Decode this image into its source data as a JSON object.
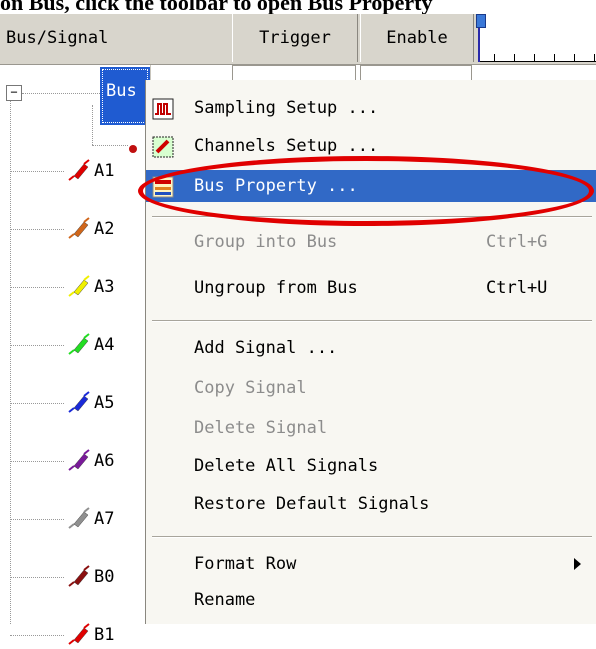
{
  "caption": "on Bus, click the toolbar to open Bus Property",
  "header": {
    "bus_signal": "Bus/Signal",
    "trigger": "Trigger",
    "enable": "Enable"
  },
  "tree": {
    "bus_label": "Bus",
    "signals": [
      {
        "name": "A1",
        "color": "#e00000"
      },
      {
        "name": "A2",
        "color": "#d0661a"
      },
      {
        "name": "A3",
        "color": "#f0f000"
      },
      {
        "name": "A4",
        "color": "#22dd22"
      },
      {
        "name": "A5",
        "color": "#1a2ad8"
      },
      {
        "name": "A6",
        "color": "#7a1a9a"
      },
      {
        "name": "A7",
        "color": "#909090"
      },
      {
        "name": "B0",
        "color": "#8a1010"
      },
      {
        "name": "B1",
        "color": "#e00000"
      }
    ]
  },
  "menu": {
    "sampling_setup": "Sampling Setup ...",
    "channels_setup": "Channels Setup ...",
    "bus_property": "Bus Property ...",
    "group_into_bus": "Group into Bus",
    "group_shortcut": "Ctrl+G",
    "ungroup_from_bus": "Ungroup from Bus",
    "ungroup_shortcut": "Ctrl+U",
    "add_signal": "Add Signal ...",
    "copy_signal": "Copy Signal",
    "delete_signal": "Delete Signal",
    "delete_all_signals": "Delete All Signals",
    "restore_default_signals": "Restore Default Signals",
    "format_row": "Format Row",
    "rename": "Rename"
  },
  "colors": {
    "highlight": "#3169c6",
    "annotation": "#e00000"
  }
}
